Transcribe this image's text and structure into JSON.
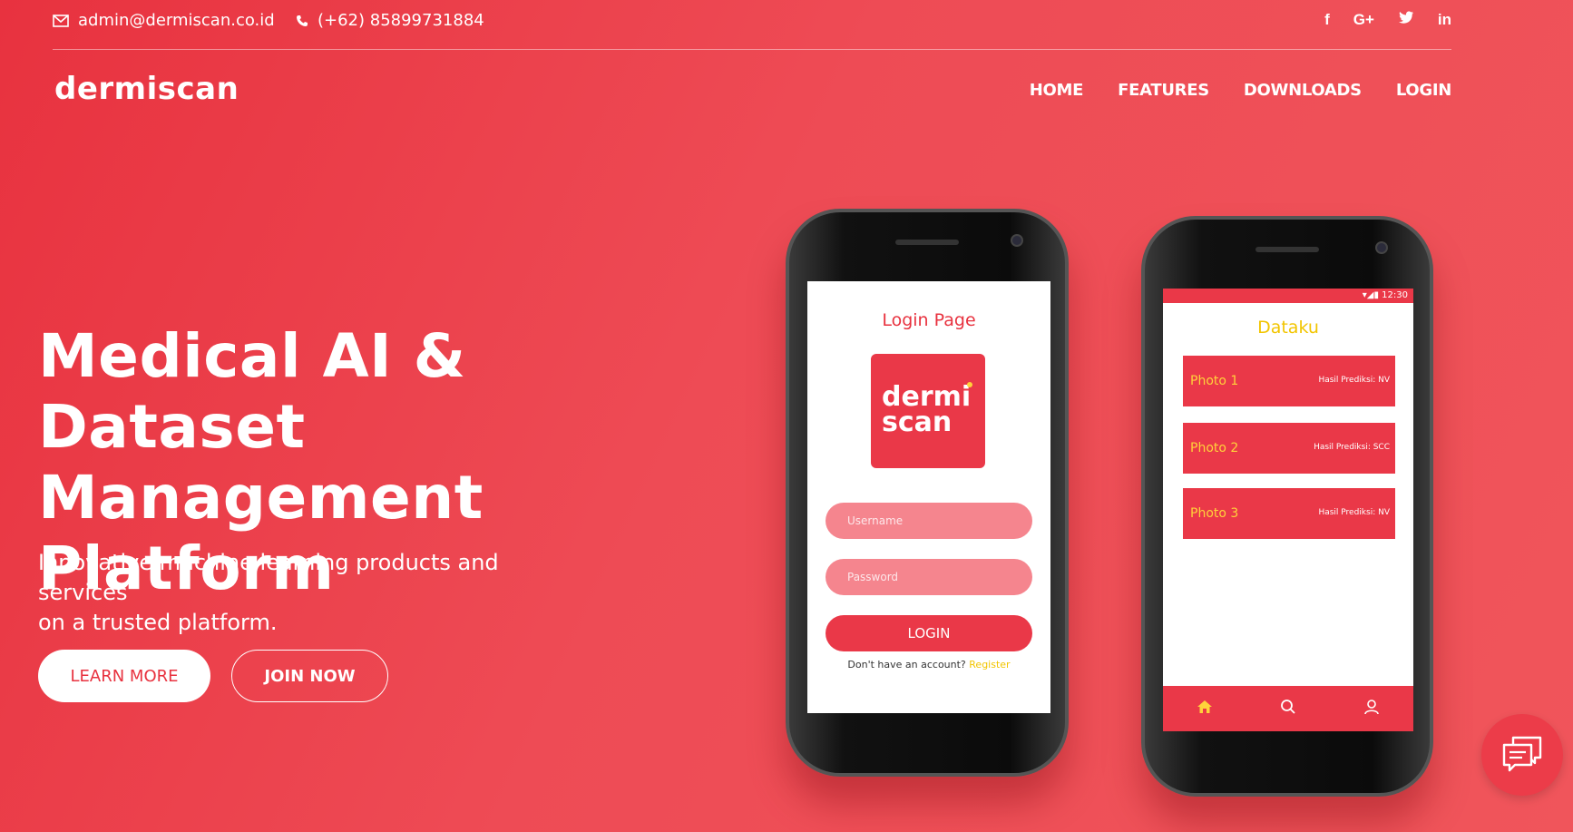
{
  "topbar": {
    "email": "admin@dermiscan.co.id",
    "phone": "(+62) 85899731884",
    "social": [
      "facebook-icon",
      "google-plus-icon",
      "twitter-icon",
      "linkedin-icon"
    ]
  },
  "brand": "dermiscan",
  "nav": [
    "HOME",
    "FEATURES",
    "DOWNLOADS",
    "LOGIN"
  ],
  "hero": {
    "title_lines": [
      "Medical AI & Dataset",
      "Management",
      "Platform"
    ],
    "subtitle_lines": [
      "Innovative machine learning products and services",
      "on a trusted platform."
    ],
    "learn_more": "LEARN MORE",
    "join_now": "JOIN NOW"
  },
  "phone_login": {
    "title": "Login Page",
    "logo_line1": "dermi",
    "logo_line2": "scan",
    "username_placeholder": "Username",
    "password_placeholder": "Password",
    "login_button": "LOGIN",
    "register_prompt": "Don't have an account?",
    "register_link": "Register"
  },
  "phone_dataku": {
    "status_time": "12:30",
    "title": "Dataku",
    "items": [
      {
        "name": "Photo 1",
        "result": "Hasil Prediksi: NV"
      },
      {
        "name": "Photo 2",
        "result": "Hasil Prediksi: SCC"
      },
      {
        "name": "Photo 3",
        "result": "Hasil Prediksi: NV"
      }
    ]
  },
  "colors": {
    "accent": "#e8323f",
    "highlight": "#ffd23a"
  }
}
